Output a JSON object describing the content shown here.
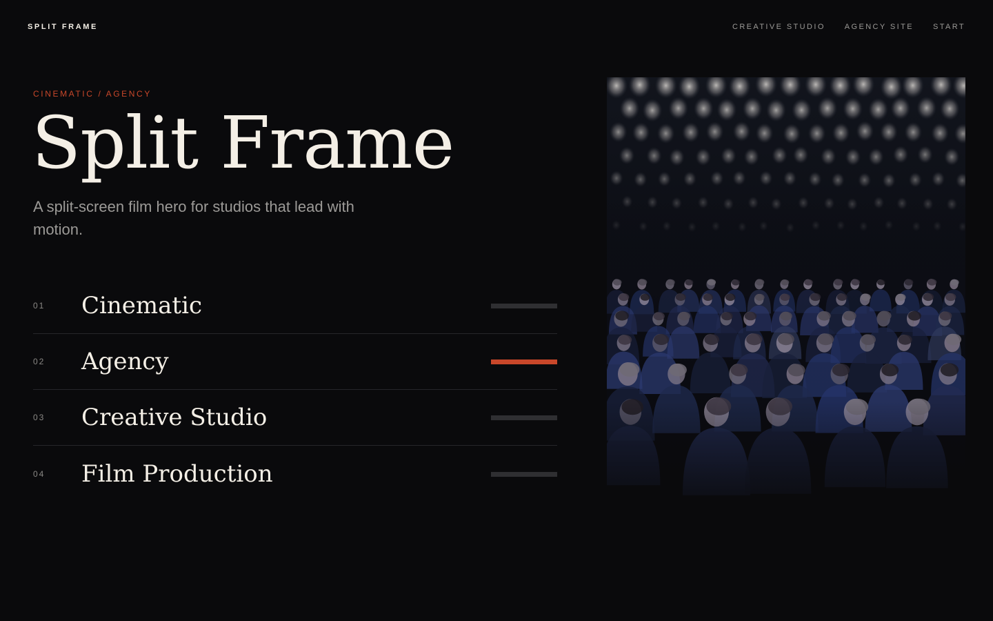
{
  "header": {
    "brand": "SPLIT FRAME",
    "nav": [
      {
        "label": "CREATIVE STUDIO"
      },
      {
        "label": "AGENCY SITE"
      },
      {
        "label": "START"
      }
    ]
  },
  "hero": {
    "eyebrow": "CINEMATIC / AGENCY",
    "title": "Split Frame",
    "subtitle": "A split-screen film hero for studios that lead with motion."
  },
  "services": {
    "active_index": 1,
    "items": [
      {
        "number": "01",
        "label": "Cinematic"
      },
      {
        "number": "02",
        "label": "Agency"
      },
      {
        "number": "03",
        "label": "Creative Studio"
      },
      {
        "number": "04",
        "label": "Film Production"
      }
    ]
  },
  "media": {
    "icon": "audience-photo"
  },
  "colors": {
    "background": "#0a0a0c",
    "accent": "#c8472a",
    "text": "#f4efe6",
    "muted": "#9c9a97",
    "bar_inactive": "#2f2f32"
  }
}
